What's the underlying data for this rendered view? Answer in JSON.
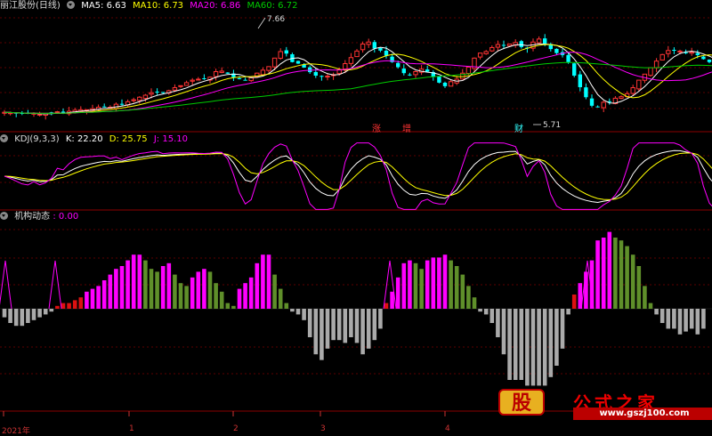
{
  "panel1": {
    "title": "丽江股份(日线)",
    "ma": [
      {
        "label": "MA5: 6.63",
        "color": "#ffffff"
      },
      {
        "label": "MA10: 6.73",
        "color": "#ffff00"
      },
      {
        "label": "MA20: 6.86",
        "color": "#ff00ff"
      },
      {
        "label": "MA60: 6.72",
        "color": "#00cc00"
      }
    ],
    "high_label": "7.66",
    "low_label": "5.71",
    "markers": [
      "涨",
      "增",
      "财"
    ]
  },
  "panel2": {
    "title": "KDJ(9,3,3)",
    "k": "K: 22.20",
    "d": "D: 25.75",
    "j": "J: 15.10"
  },
  "panel3": {
    "title": "机构动态",
    "value": ": 0.00"
  },
  "x_labels": [
    "2021年",
    "1",
    "2",
    "3",
    "4"
  ],
  "watermark": {
    "logo": "股",
    "name": "公式之家",
    "url": "www.gszj100.com"
  },
  "colors": {
    "up": "#ff3333",
    "down": "#00ffff",
    "hist_neg": "#aaaaaa",
    "hist_magenta": "#ff00ff",
    "hist_red": "#dd1111",
    "hist_green": "#5f8f2a",
    "grid": "#7a0000",
    "sep": "#8b0000"
  },
  "chart_data": [
    {
      "type": "candlestick",
      "title": "丽江股份(日线)",
      "series": [
        {
          "name": "MA5",
          "last": 6.63
        },
        {
          "name": "MA10",
          "last": 6.73
        },
        {
          "name": "MA20",
          "last": 6.86
        },
        {
          "name": "MA60",
          "last": 6.72
        }
      ],
      "close": [
        5.76,
        5.75,
        5.74,
        5.73,
        5.73,
        5.74,
        5.72,
        5.73,
        5.74,
        5.77,
        5.75,
        5.78,
        5.8,
        5.81,
        5.81,
        5.83,
        5.86,
        5.87,
        5.86,
        5.92,
        5.91,
        5.97,
        6.01,
        6.06,
        6.1,
        6.15,
        6.16,
        6.15,
        6.19,
        6.25,
        6.29,
        6.35,
        6.4,
        6.42,
        6.43,
        6.46,
        6.57,
        6.58,
        6.53,
        6.46,
        6.42,
        6.4,
        6.45,
        6.54,
        6.6,
        6.67,
        6.84,
        6.97,
        6.93,
        6.76,
        6.73,
        6.65,
        6.56,
        6.49,
        6.47,
        6.48,
        6.51,
        6.61,
        6.73,
        6.85,
        6.98,
        7.12,
        7.16,
        7.03,
        6.99,
        6.89,
        6.76,
        6.66,
        6.54,
        6.5,
        6.57,
        6.62,
        6.57,
        6.47,
        6.35,
        6.28,
        6.37,
        6.42,
        6.54,
        6.66,
        6.84,
        6.94,
        6.97,
        7.05,
        7.11,
        7.09,
        7.12,
        7.15,
        7.06,
        7.03,
        7.16,
        7.22,
        7.13,
        7.02,
        6.94,
        6.9,
        6.76,
        6.49,
        6.26,
        6.06,
        5.89,
        5.86,
        5.96,
        5.96,
        6.04,
        6.07,
        6.13,
        6.25,
        6.4,
        6.52,
        6.65,
        6.78,
        6.91,
        6.99,
        7.0,
        6.98,
        6.95,
        6.96,
        6.9,
        6.82,
        6.76,
        6.7,
        6.67,
        6.63
      ],
      "high": 7.66,
      "low": 5.71
    },
    {
      "type": "line",
      "title": "KDJ(9,3,3)",
      "series": [
        {
          "name": "K",
          "last": 22.2
        },
        {
          "name": "D",
          "last": 25.75
        },
        {
          "name": "J",
          "last": 15.1
        }
      ]
    },
    {
      "type": "bar",
      "title": "机构动态",
      "last": 0.0,
      "values": [
        -3,
        -5,
        -6,
        -6,
        -5,
        -4,
        -3,
        -2,
        -1,
        1,
        2,
        2,
        3,
        4,
        6,
        7,
        8,
        10,
        12,
        14,
        15,
        17,
        19,
        19,
        17,
        14,
        13,
        15,
        16,
        12,
        9,
        8,
        11,
        13,
        14,
        13,
        9,
        6,
        2,
        1,
        7,
        9,
        11,
        16,
        19,
        19,
        12,
        7,
        2,
        -1,
        -2,
        -4,
        -10,
        -16,
        -18,
        -14,
        -11,
        -11,
        -12,
        -10,
        -12,
        -16,
        -14,
        -11,
        -7,
        2,
        6,
        11,
        16,
        17,
        16,
        14,
        17,
        18,
        18,
        19,
        17,
        15,
        12,
        8,
        4,
        -1,
        -2,
        -5,
        -10,
        -16,
        -25,
        -25,
        -25,
        -27,
        -27,
        -27,
        -27,
        -24,
        -20,
        -14,
        -2,
        5,
        9,
        13,
        17,
        24,
        25,
        27,
        25,
        24,
        22,
        19,
        15,
        8,
        2,
        -2,
        -5,
        -7,
        -7,
        -9,
        -8,
        -7,
        -9,
        -7
      ]
    }
  ]
}
